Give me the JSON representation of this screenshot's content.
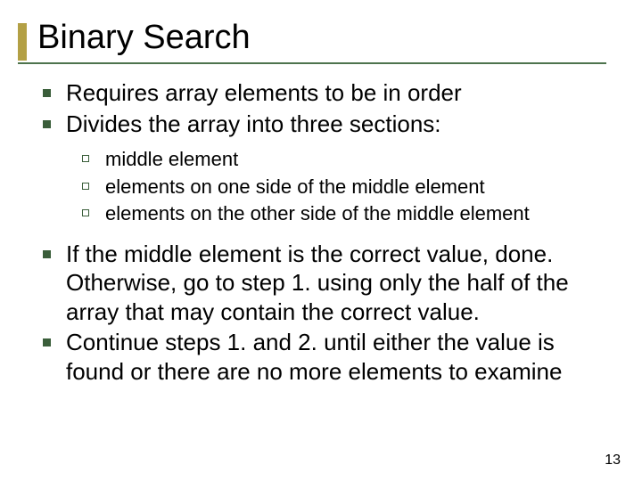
{
  "slide": {
    "title": "Binary Search",
    "bullets": [
      {
        "text": "Requires array elements to be in order"
      },
      {
        "text": "Divides the array into three sections:",
        "sub": [
          "middle element",
          "elements on one side of the middle element",
          "elements on the other side of the middle element"
        ]
      },
      {
        "text": "If the middle element is the correct value, done. Otherwise, go to step 1. using only the half of the array that may contain the correct value."
      },
      {
        "text": "Continue steps 1. and 2. until either the value is found or there are no more elements to examine"
      }
    ],
    "page_number": "13"
  }
}
